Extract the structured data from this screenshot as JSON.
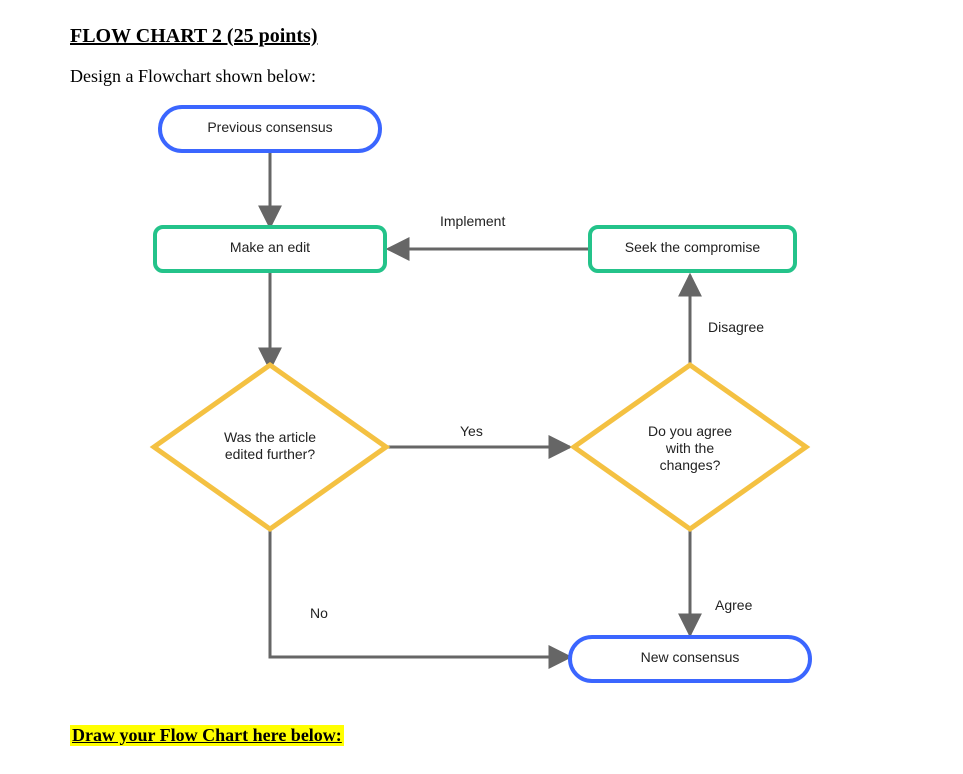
{
  "heading": "FLOW CHART 2 (25 points)",
  "subheading": "Design a Flowchart shown below:",
  "bottom_note": "Draw your Flow Chart here below:",
  "colors": {
    "terminator": "#3b66ff",
    "process": "#24c38a",
    "decision": "#f4c142",
    "line": "#666666"
  },
  "chart_data": {
    "type": "flowchart",
    "nodes": [
      {
        "id": "prev",
        "shape": "terminator",
        "label": "Previous consensus"
      },
      {
        "id": "edit",
        "shape": "process",
        "label": "Make an edit"
      },
      {
        "id": "seek",
        "shape": "process",
        "label": "Seek the compromise"
      },
      {
        "id": "wasEdited",
        "shape": "decision",
        "label": "Was the article\nedited further?"
      },
      {
        "id": "agreeQ",
        "shape": "decision",
        "label": "Do you agree\nwith the\nchanges?"
      },
      {
        "id": "newCons",
        "shape": "terminator",
        "label": "New consensus"
      }
    ],
    "edges": [
      {
        "from": "prev",
        "to": "edit",
        "label": ""
      },
      {
        "from": "seek",
        "to": "edit",
        "label": "Implement"
      },
      {
        "from": "edit",
        "to": "wasEdited",
        "label": ""
      },
      {
        "from": "wasEdited",
        "to": "agreeQ",
        "label": "Yes"
      },
      {
        "from": "wasEdited",
        "to": "newCons",
        "label": "No"
      },
      {
        "from": "agreeQ",
        "to": "seek",
        "label": "Disagree"
      },
      {
        "from": "agreeQ",
        "to": "newCons",
        "label": "Agree"
      }
    ]
  }
}
